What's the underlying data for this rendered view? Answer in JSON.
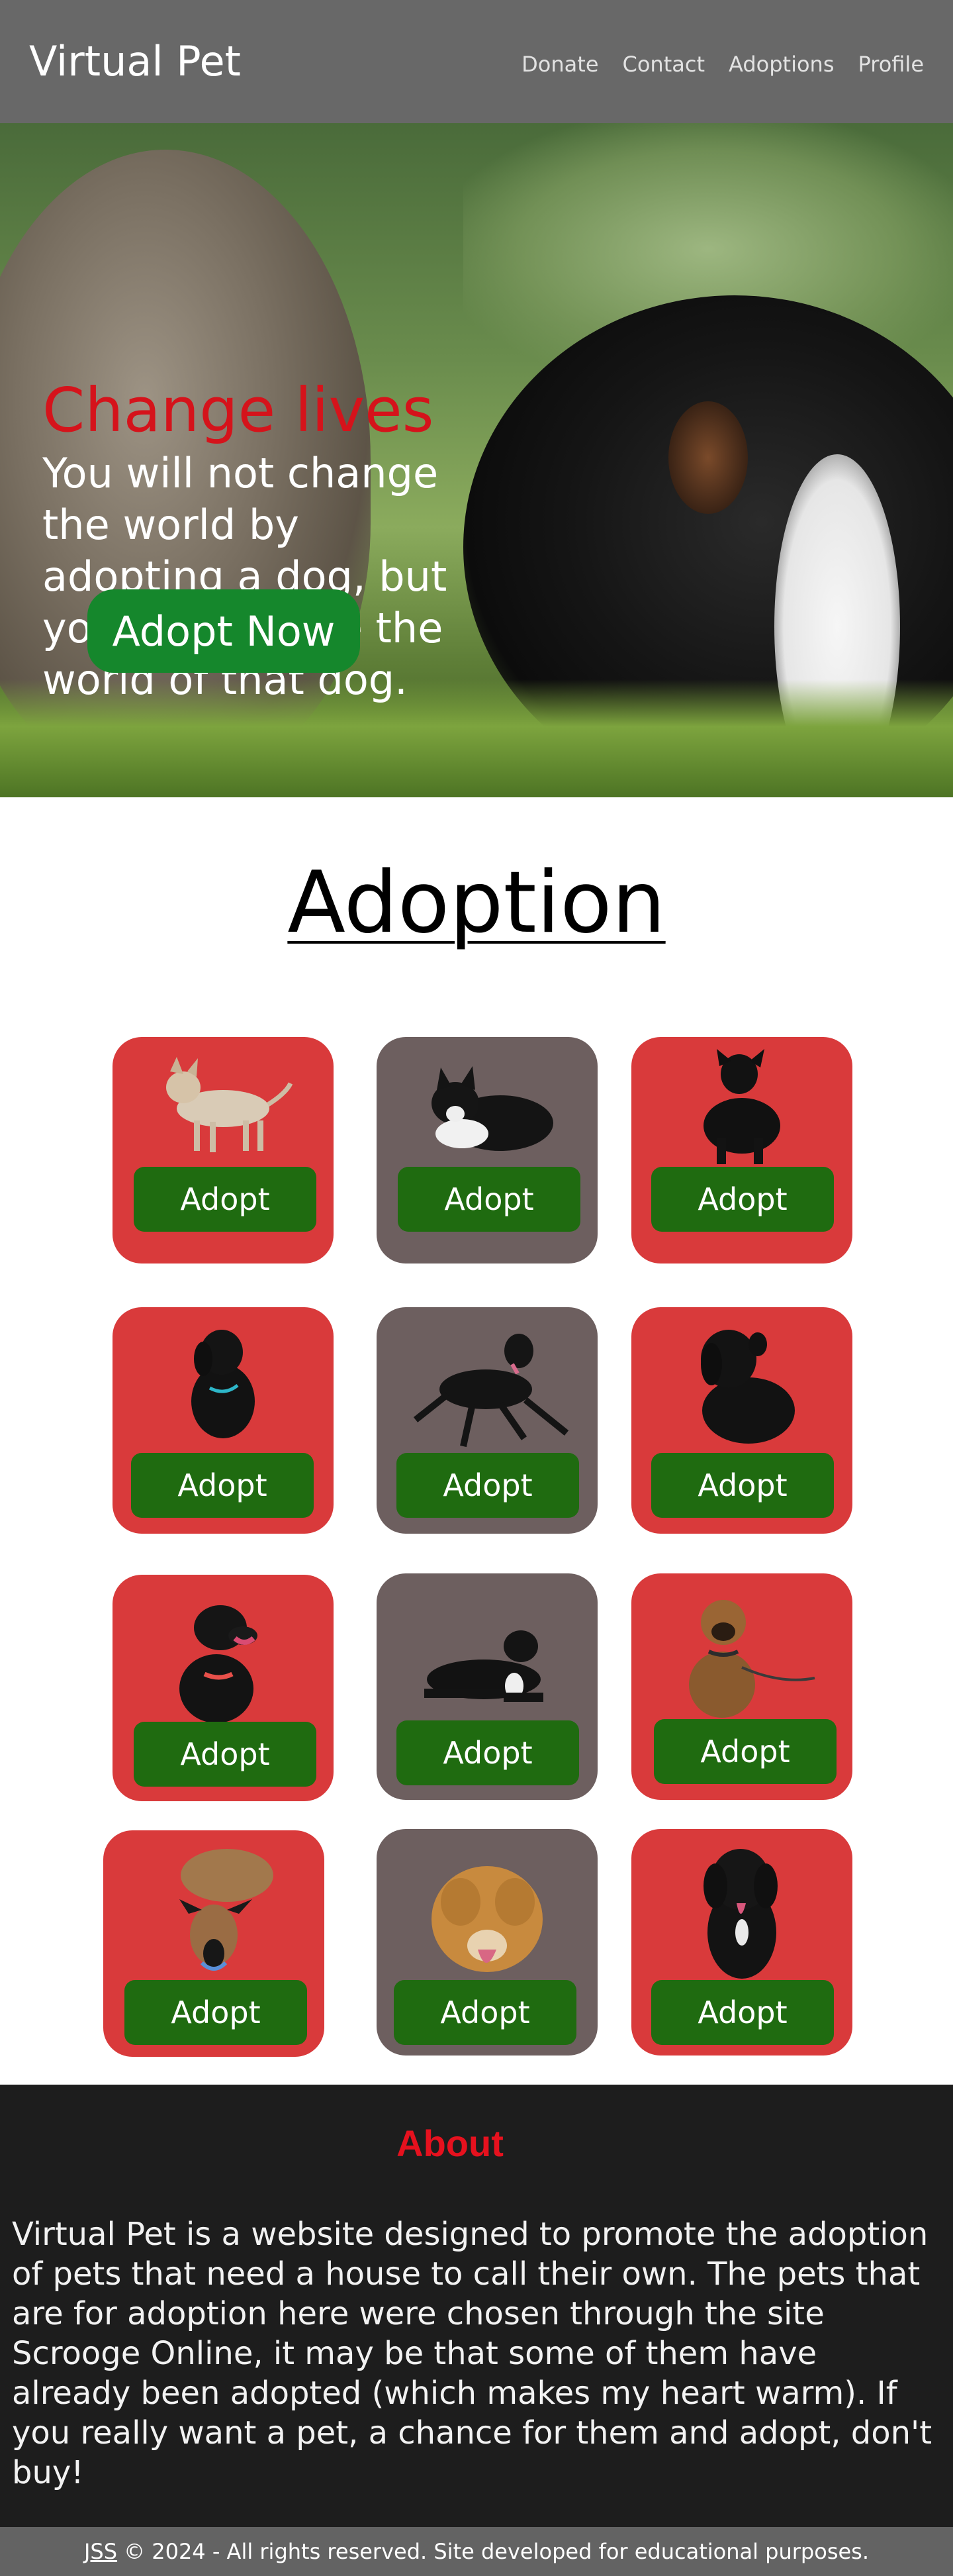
{
  "header": {
    "brand": "Virtual Pet",
    "nav": [
      "Donate",
      "Contact",
      "Adoptions",
      "Profile"
    ]
  },
  "hero": {
    "title": "Change lives",
    "text": "You will not change the world by adopting a dog, but you will change the world of that dog.",
    "button": "Adopt Now"
  },
  "adoption": {
    "title": "Adoption",
    "cards": [
      {
        "button": "Adopt",
        "color": "#d93a3b",
        "pet": "dog-icon"
      },
      {
        "button": "Adopt",
        "color": "#6d5f5f",
        "pet": "cat-icon"
      },
      {
        "button": "Adopt",
        "color": "#d93a3b",
        "pet": "dog-icon"
      },
      {
        "button": "Adopt",
        "color": "#d93a3b",
        "pet": "dog-icon"
      },
      {
        "button": "Adopt",
        "color": "#6d5f5f",
        "pet": "dog-icon"
      },
      {
        "button": "Adopt",
        "color": "#d93a3b",
        "pet": "dog-icon"
      },
      {
        "button": "Adopt",
        "color": "#d93a3b",
        "pet": "dog-icon"
      },
      {
        "button": "Adopt",
        "color": "#6d5f5f",
        "pet": "dog-icon"
      },
      {
        "button": "Adopt",
        "color": "#d93a3b",
        "pet": "dog-icon"
      },
      {
        "button": "Adopt",
        "color": "#d93a3b",
        "pet": "dog-icon"
      },
      {
        "button": "Adopt",
        "color": "#6d5f5f",
        "pet": "dog-icon"
      },
      {
        "button": "Adopt",
        "color": "#d93a3b",
        "pet": "dog-icon"
      }
    ]
  },
  "about": {
    "title": "About",
    "text": "Virtual Pet is a website designed to promote the adoption of pets that need a house to call their own. The pets that are for adoption here were chosen through the site Scrooge Online, it may be that some of them have already been adopted (which makes my heart warm). If you really want a pet, a chance for them and adopt, don't buy!"
  },
  "footer": {
    "link": "JSS",
    "text": "© 2024 - All rights reserved. Site developed for educational purposes."
  },
  "colors": {
    "header": "#686868",
    "hero_title": "#d5131b",
    "hero_button": "#15872c",
    "card_red": "#d93a3b",
    "card_gray": "#6d5f5f",
    "adopt_button": "#1f6b10",
    "about_bg": "#1d1d1d",
    "about_title": "#e6111e",
    "copyright_bg": "#636363"
  }
}
